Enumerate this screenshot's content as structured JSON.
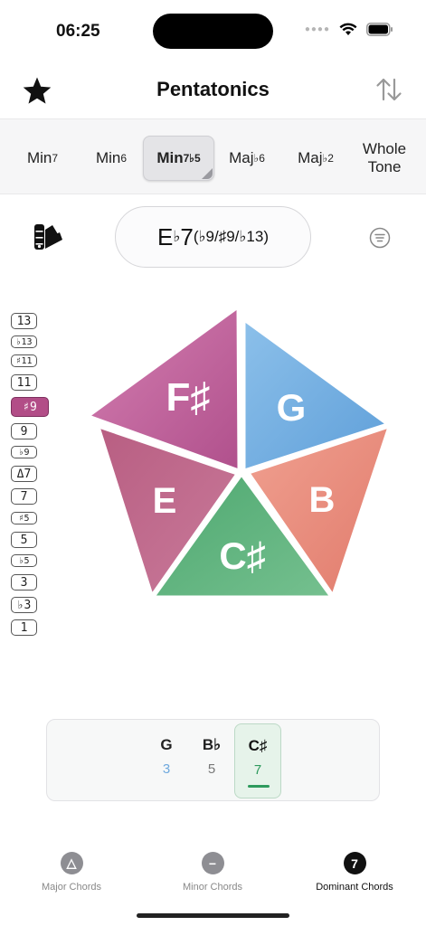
{
  "status": {
    "time": "06:25"
  },
  "header": {
    "title": "Pentatonics",
    "favorite_icon": "star-icon",
    "sort_icon": "sort-arrows-icon"
  },
  "scale_tabs": [
    {
      "label": "Min",
      "sup": "7",
      "active": false
    },
    {
      "label": "Min",
      "sup": "6",
      "active": false
    },
    {
      "label": "Min",
      "sup": "7♭5",
      "active": true
    },
    {
      "label": "Maj",
      "sup": "♭6",
      "active": false
    },
    {
      "label": "Maj",
      "sup": "♭2",
      "active": false
    },
    {
      "label": "Whole Tone",
      "sup": "",
      "active": false
    }
  ],
  "chord": {
    "root": "E",
    "accidental": "♭",
    "quality": "7",
    "extensions": "(♭9/♯9/♭13)"
  },
  "intervals": [
    "13",
    "♭13",
    "♯11",
    "11",
    "♯9",
    "9",
    "♭9",
    "Δ7",
    "7",
    "♯5",
    "5",
    "♭5",
    "3",
    "♭3",
    "1"
  ],
  "active_interval": "♯9",
  "pentagon": {
    "notes": [
      {
        "name": "F♯",
        "color": "#c05d98"
      },
      {
        "name": "G",
        "color": "#6fa9de"
      },
      {
        "name": "B",
        "color": "#e88a7c"
      },
      {
        "name": "C♯",
        "color": "#5fb07e"
      },
      {
        "name": "E",
        "color": "#b9668a"
      }
    ]
  },
  "note_strip": [
    {
      "note": "G",
      "degree": "3",
      "color": "#6fa9de",
      "active": false
    },
    {
      "note": "B♭",
      "degree": "5",
      "color": "#777777",
      "active": false
    },
    {
      "note": "C♯",
      "degree": "7",
      "color": "#2e9a5d",
      "active": true
    }
  ],
  "tabbar": [
    {
      "label": "Major Chords",
      "glyph": "△",
      "active": false
    },
    {
      "label": "Minor Chords",
      "glyph": "−",
      "active": false
    },
    {
      "label": "Dominant Chords",
      "glyph": "7",
      "active": true
    }
  ]
}
